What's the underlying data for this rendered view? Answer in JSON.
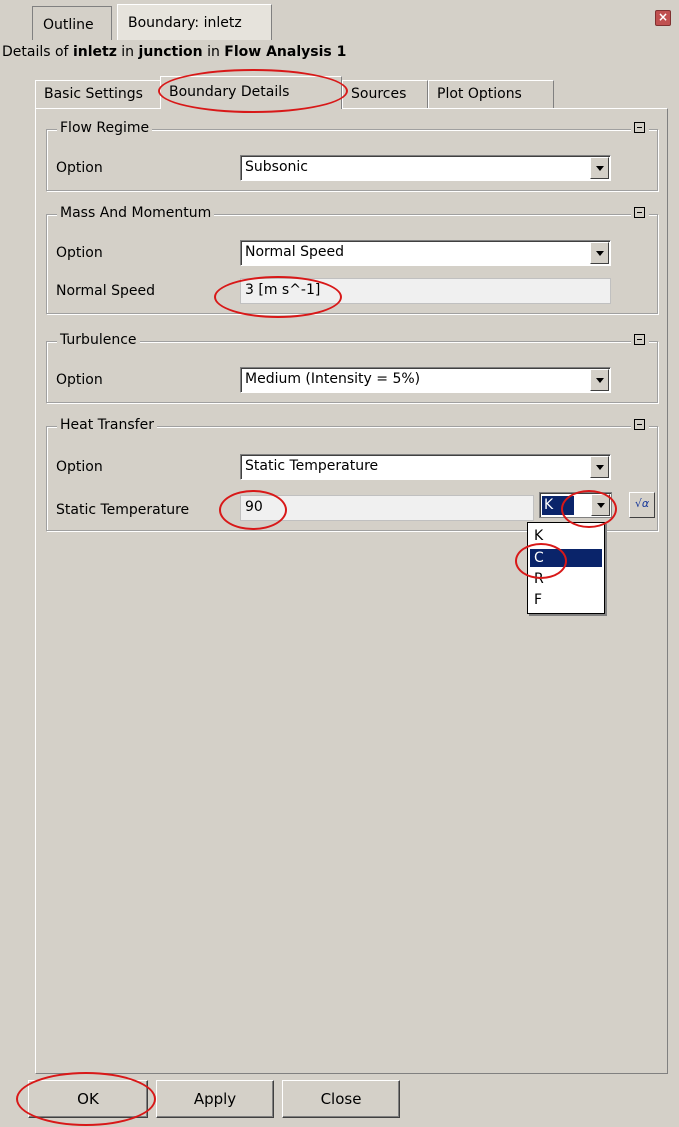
{
  "top_tabs": {
    "outline": "Outline",
    "boundary": "Boundary: inletz"
  },
  "close_glyph": "×",
  "details": {
    "prefix": "Details of ",
    "object": "inletz",
    "in1": " in ",
    "domain": "junction",
    "in2": " in ",
    "analysis": "Flow Analysis 1"
  },
  "sub_tabs": {
    "basic": "Basic Settings",
    "boundary": "Boundary Details",
    "sources": "Sources",
    "plot": "Plot Options"
  },
  "groups": {
    "flow_regime": {
      "title": "Flow Regime",
      "option_label": "Option",
      "option_value": "Subsonic"
    },
    "mass_momentum": {
      "title": "Mass And Momentum",
      "option_label": "Option",
      "option_value": "Normal Speed",
      "speed_label": "Normal Speed",
      "speed_value": "3 [m s^-1]"
    },
    "turbulence": {
      "title": "Turbulence",
      "option_label": "Option",
      "option_value": "Medium (Intensity = 5%)"
    },
    "heat_transfer": {
      "title": "Heat Transfer",
      "option_label": "Option",
      "option_value": "Static Temperature",
      "temp_label": "Static Temperature",
      "temp_value": "90",
      "unit_value": "K"
    }
  },
  "unit_options": [
    "K",
    "C",
    "R",
    "F"
  ],
  "unit_selected": "C",
  "buttons": {
    "ok": "OK",
    "apply": "Apply",
    "close": "Close"
  },
  "colors": {
    "annotation": "#d81818",
    "selection": "#0a246a",
    "background": "#d4d0c8"
  }
}
